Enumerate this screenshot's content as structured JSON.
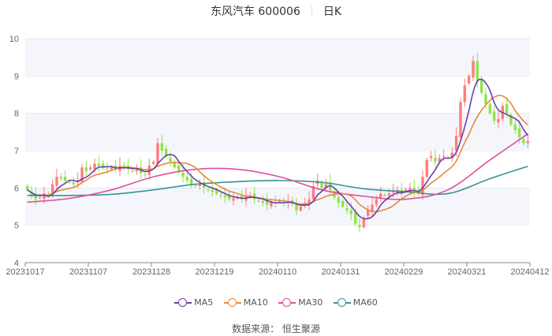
{
  "header": {
    "stock_name": "东风汽车 600006",
    "period": "日K"
  },
  "source": "数据来源： 恒生聚源",
  "colors": {
    "up": "#ff7c7c",
    "down": "#8fe34a",
    "ma5": "#6b3fa8",
    "ma10": "#e8893a",
    "ma30": "#de4f9f",
    "ma60": "#399494",
    "band": "#f4f6fb",
    "axis": "#888888"
  },
  "chart_data": {
    "type": "candlestick",
    "title": "东风汽车 600006 日K",
    "ylim": [
      4,
      10
    ],
    "yticks": [
      "4",
      "5",
      "6",
      "7",
      "8",
      "9",
      "10"
    ],
    "xticks": [
      "20231017",
      "20231107",
      "20231128",
      "20231219",
      "20240110",
      "20240131",
      "20240229",
      "20240321",
      "20240412"
    ],
    "legend": [
      "MA5",
      "MA10",
      "MA30",
      "MA60"
    ],
    "legend_position": "bottom",
    "close": [
      5.95,
      5.8,
      5.7,
      5.75,
      5.85,
      5.78,
      6.1,
      6.3,
      6.25,
      6.2,
      6.15,
      6.1,
      6.2,
      6.55,
      6.45,
      6.55,
      6.65,
      6.6,
      6.55,
      6.5,
      6.55,
      6.5,
      6.6,
      6.55,
      6.5,
      6.45,
      6.5,
      6.4,
      6.35,
      6.6,
      6.7,
      7.2,
      7.0,
      6.85,
      6.7,
      6.55,
      6.45,
      6.3,
      6.2,
      6.1,
      6.05,
      6.1,
      6.0,
      5.95,
      5.9,
      5.85,
      5.8,
      5.75,
      5.7,
      5.72,
      5.75,
      5.7,
      5.78,
      5.8,
      5.7,
      5.65,
      5.6,
      5.55,
      5.62,
      5.6,
      5.65,
      5.6,
      5.62,
      5.58,
      5.4,
      5.5,
      5.6,
      5.7,
      6.05,
      6.2,
      6.0,
      6.1,
      5.95,
      5.75,
      5.6,
      5.5,
      5.4,
      5.3,
      5.05,
      4.95,
      5.2,
      5.4,
      5.55,
      5.7,
      5.85,
      5.8,
      5.85,
      5.9,
      5.95,
      5.85,
      5.95,
      6.0,
      5.9,
      5.85,
      6.3,
      6.75,
      6.85,
      6.7,
      6.8,
      6.85,
      6.8,
      6.95,
      7.4,
      8.3,
      8.75,
      9.0,
      9.4,
      8.85,
      8.55,
      8.25,
      8.0,
      7.8,
      7.85,
      8.2,
      8.0,
      7.7,
      7.55,
      7.35,
      7.2,
      7.25
    ],
    "open_first": 6.05,
    "ma30_samples_every10": [
      5.62,
      5.72,
      5.95,
      6.3,
      6.5,
      6.5,
      6.3,
      5.95,
      5.78,
      5.7,
      5.95,
      6.75,
      7.45
    ],
    "ma60_samples_every10": [
      5.8,
      5.8,
      5.83,
      5.95,
      6.1,
      6.17,
      6.2,
      6.15,
      5.98,
      5.9,
      5.85,
      6.25,
      6.58
    ]
  }
}
